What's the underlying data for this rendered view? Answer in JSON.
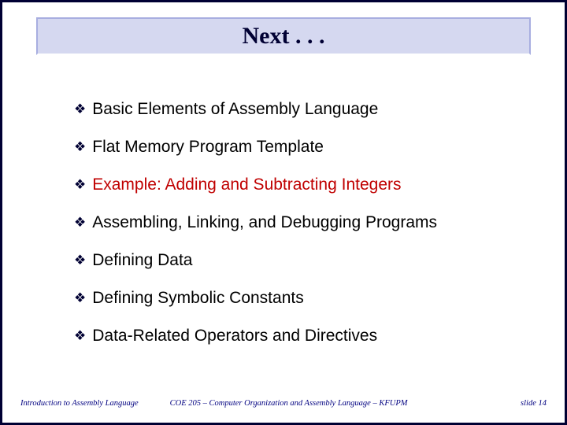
{
  "title": "Next . . .",
  "bullets": [
    {
      "text": "Basic Elements of Assembly Language",
      "highlight": false
    },
    {
      "text": "Flat Memory Program Template",
      "highlight": false
    },
    {
      "text": "Example: Adding and Subtracting Integers",
      "highlight": true
    },
    {
      "text": "Assembling, Linking, and Debugging Programs",
      "highlight": false
    },
    {
      "text": "Defining Data",
      "highlight": false
    },
    {
      "text": "Defining Symbolic Constants",
      "highlight": false
    },
    {
      "text": "Data-Related Operators and Directives",
      "highlight": false
    }
  ],
  "footer": {
    "left": "Introduction to Assembly Language",
    "center": "COE 205 – Computer Organization and Assembly Language – KFUPM",
    "right": "slide 14"
  }
}
